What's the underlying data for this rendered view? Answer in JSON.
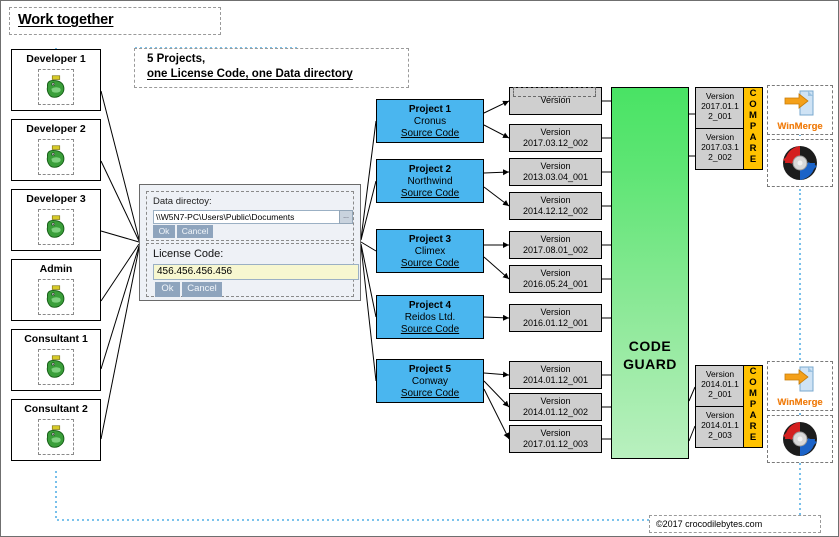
{
  "title": {
    "text": "Work together"
  },
  "note": {
    "line1": "5 Projects,",
    "line2": "one License Code, one Data directory"
  },
  "actors": [
    {
      "label": "Developer 1",
      "icon": "crocodile-icon"
    },
    {
      "label": "Developer 2",
      "icon": "crocodile-icon"
    },
    {
      "label": "Developer 3",
      "icon": "crocodile-icon"
    },
    {
      "label": "Admin",
      "icon": "crocodile-icon"
    },
    {
      "label": "Consultant 1",
      "icon": "crocodile-icon"
    },
    {
      "label": "Consultant 2",
      "icon": "crocodile-icon"
    }
  ],
  "dialog": {
    "data_directory_label": "Data directoy:",
    "data_directory_value": "\\\\W5N7-PC\\Users\\Public\\Documents",
    "browse_label": "...",
    "ok_label_1": "Ok",
    "cancel_label_1": "Cancel",
    "license_code_label": "License Code:",
    "license_code_value": "456.456.456.456",
    "ok_label_2": "Ok",
    "cancel_label_2": "Cancel"
  },
  "projects": [
    {
      "name": "Project 1",
      "client": "Cronus",
      "kind": "Source Code"
    },
    {
      "name": "Project 2",
      "client": "Northwind",
      "kind": "Source Code"
    },
    {
      "name": "Project 3",
      "client": "Climex",
      "kind": "Source Code"
    },
    {
      "name": "Project 4",
      "client": "Reidos Ltd.",
      "kind": "Source Code"
    },
    {
      "name": "Project 5",
      "client": "Conway",
      "kind": "Source Code"
    }
  ],
  "versions": [
    {
      "label": "Version",
      "id": ""
    },
    {
      "label": "Version",
      "id": "2017.03.12_002"
    },
    {
      "label": "Version",
      "id": "2013.03.04_001"
    },
    {
      "label": "Version",
      "id": "2014.12.12_002"
    },
    {
      "label": "Version",
      "id": "2017.08.01_002"
    },
    {
      "label": "Version",
      "id": "2016.05.24_001"
    },
    {
      "label": "Version",
      "id": "2016.01.12_001"
    },
    {
      "label": "Version",
      "id": "2014.01.12_001"
    },
    {
      "label": "Version",
      "id": "2014.01.12_002"
    },
    {
      "label": "Version",
      "id": "2017.01.12_003"
    }
  ],
  "codeguard": {
    "line1": "CODE",
    "line2": "GUARD",
    "color": "#49e364"
  },
  "compare_groups": [
    {
      "bar_label": "COMPARE",
      "bar_color": "#ffc200",
      "items": [
        {
          "label": "Version",
          "id_line1": "2017.01.1",
          "id_line2": "2_001"
        },
        {
          "label": "Version",
          "id_line1": "2017.03.1",
          "id_line2": "2_002"
        }
      ]
    },
    {
      "bar_label": "COMPARE",
      "bar_color": "#ffc200",
      "items": [
        {
          "label": "Version",
          "id_line1": "2014.01.1",
          "id_line2": "2_001"
        },
        {
          "label": "Version",
          "id_line1": "2014.01.1",
          "id_line2": "2_003"
        }
      ]
    }
  ],
  "tools": [
    {
      "name": "WinMerge",
      "icon": "winmerge-icon",
      "label": "WinMerge"
    },
    {
      "name": "Beyond Compare",
      "icon": "beyondcompare-icon",
      "label": ""
    },
    {
      "name": "WinMerge",
      "icon": "winmerge-icon",
      "label": "WinMerge"
    },
    {
      "name": "Beyond Compare",
      "icon": "beyondcompare-icon",
      "label": ""
    }
  ],
  "footer": {
    "text": "©2017 crocodilebytes.com"
  }
}
